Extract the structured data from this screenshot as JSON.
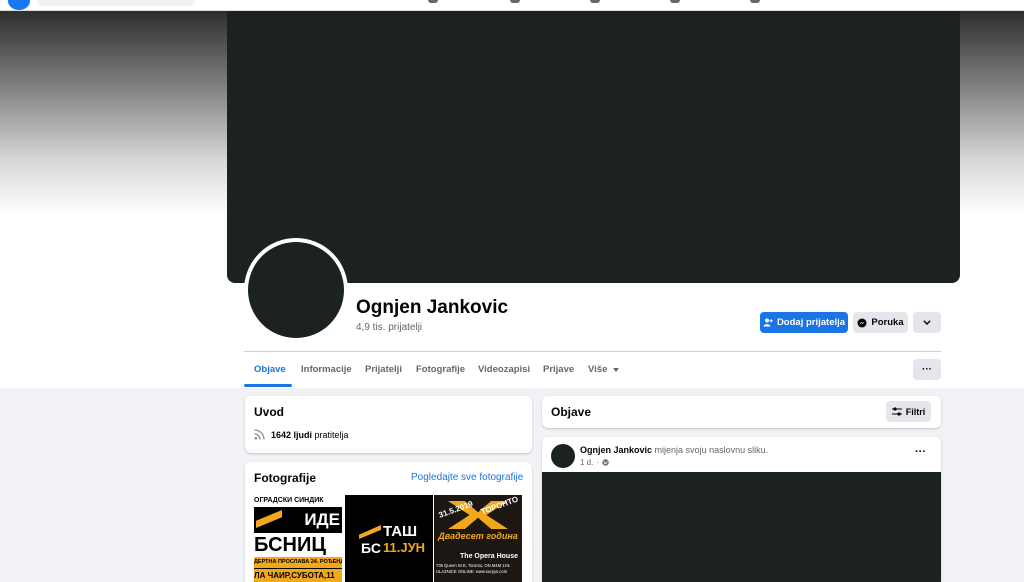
{
  "profile": {
    "name": "Ognjen Jankovic",
    "friends_count": "4,9 tis. prijatelji"
  },
  "actions": {
    "add_friend": "Dodaj prijatelja",
    "message": "Poruka"
  },
  "tabs": [
    {
      "label": "Objave",
      "active": true
    },
    {
      "label": "Informacije"
    },
    {
      "label": "Prijatelji"
    },
    {
      "label": "Fotografije"
    },
    {
      "label": "Videozapisi"
    },
    {
      "label": "Prijave"
    },
    {
      "label": "Više"
    }
  ],
  "tabs_more_icon": "ellipsis-icon",
  "intro": {
    "title": "Uvod",
    "followers_count": "1642 ljudi",
    "followers_suffix": "pratitelja"
  },
  "photos": {
    "title": "Fotografije",
    "see_all": "Pogledajte sve fotografije",
    "items": [
      {
        "top": "ОГРАДСКИ СИНДИК",
        "mid": "ИДЕ",
        "mid2": "БСНИЦ",
        "bottom": "ДЕРТНА ПРОСЛАВА 24. РОЂЕНД",
        "bottom2": "ЛА ЧАИР,СУБОТА,11"
      },
      {
        "top": "ТАШ",
        "mid": "БС",
        "mid2": "11.ЈУН"
      },
      {
        "top": "31.5.2019",
        "mid": "ТОРОНТО",
        "mid2": "XX",
        "sub": "Двадесет година",
        "venue": "The Opera House",
        "address": "735 Queen St E, Toronto, ON M4M 1H1",
        "tickets": "ULAZNICE ONLINE: www.surpys.com"
      }
    ]
  },
  "posts": {
    "title": "Objave",
    "filter": "Filtri"
  },
  "post": {
    "author": "Ognjen Jankovic",
    "action": "mijenja svoju naslovnu sliku.",
    "time": "1 d.",
    "menu": "···"
  },
  "colors": {
    "accent": "#1b74e4",
    "cover": "#1c231f"
  }
}
